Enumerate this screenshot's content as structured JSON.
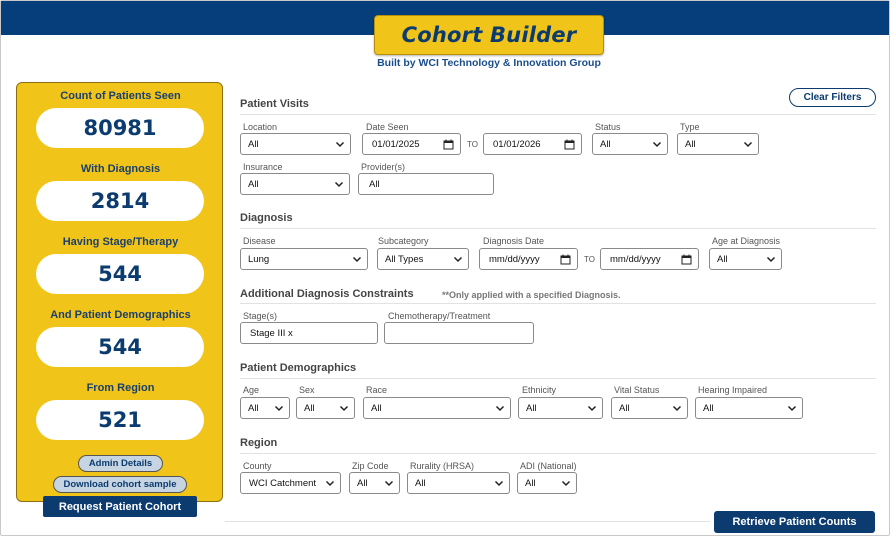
{
  "header": {
    "title": "Cohort Builder",
    "subtitle": "Built by WCI Technology & Innovation Group"
  },
  "sidebar": {
    "stats": [
      {
        "label": "Count of Patients Seen",
        "value": "80981"
      },
      {
        "label": "With Diagnosis",
        "value": "2814"
      },
      {
        "label": "Having Stage/Therapy",
        "value": "544"
      },
      {
        "label": "And Patient Demographics",
        "value": "544"
      },
      {
        "label": "From Region",
        "value": "521"
      }
    ],
    "admin_details": "Admin Details",
    "download_sample": "Download cohort sample",
    "request_cohort": "Request Patient Cohort"
  },
  "actions": {
    "clear_filters": "Clear Filters",
    "retrieve_counts": "Retrieve Patient Counts"
  },
  "visits": {
    "title": "Patient Visits",
    "location_label": "Location",
    "location_value": "All",
    "date_seen_label": "Date Seen",
    "date_from": "01/01/2025",
    "to": "TO",
    "date_to": "01/01/2026",
    "status_label": "Status",
    "status_value": "All",
    "type_label": "Type",
    "type_value": "All",
    "insurance_label": "Insurance",
    "insurance_value": "All",
    "providers_label": "Provider(s)",
    "providers_value": "All"
  },
  "diagnosis": {
    "title": "Diagnosis",
    "disease_label": "Disease",
    "disease_value": "Lung",
    "subcategory_label": "Subcategory",
    "subcategory_value": "All Types",
    "date_label": "Diagnosis Date",
    "date_from": "mm/dd/yyyy",
    "to": "TO",
    "date_to": "mm/dd/yyyy",
    "age_label": "Age at Diagnosis",
    "age_value": "All"
  },
  "constraints": {
    "title": "Additional Diagnosis Constraints",
    "note": "**Only applied with a specified Diagnosis.",
    "stages_label": "Stage(s)",
    "stages_value": "Stage III x",
    "chemo_label": "Chemotherapy/Treatment",
    "chemo_value": ""
  },
  "demographics": {
    "title": "Patient Demographics",
    "age_label": "Age",
    "age_value": "All",
    "sex_label": "Sex",
    "sex_value": "All",
    "race_label": "Race",
    "race_value": "All",
    "ethnicity_label": "Ethnicity",
    "ethnicity_value": "All",
    "vital_label": "Vital Status",
    "vital_value": "All",
    "hearing_label": "Hearing Impaired",
    "hearing_value": "All"
  },
  "region": {
    "title": "Region",
    "county_label": "County",
    "county_value": "WCI Catchment",
    "zip_label": "Zip Code",
    "zip_value": "All",
    "rurality_label": "Rurality (HRSA)",
    "rurality_value": "All",
    "adi_label": "ADI (National)",
    "adi_value": "All"
  },
  "colors": {
    "navy": "#053e7a",
    "gold": "#f0c419",
    "text_blue": "#0b3b6f"
  }
}
